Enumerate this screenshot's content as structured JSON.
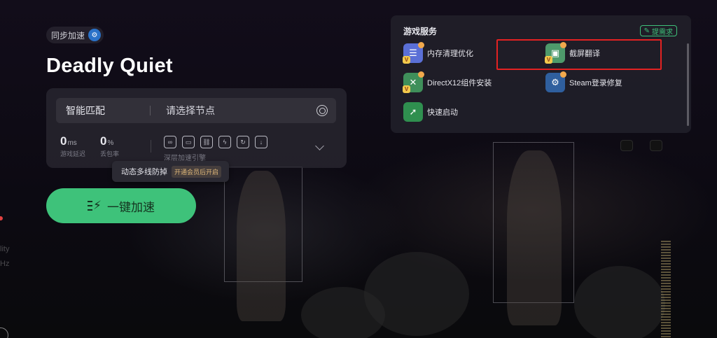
{
  "game": {
    "sync_label": "同步加速",
    "title": "Deadly Quiet"
  },
  "mode": {
    "current": "智能匹配",
    "node_placeholder": "请选择节点"
  },
  "stats": {
    "latency_value": "0",
    "latency_unit": "ms",
    "latency_label": "游戏延迟",
    "loss_value": "0",
    "loss_unit": "%",
    "loss_label": "丢包率",
    "engine_label": "深层加速引擎"
  },
  "tooltip": {
    "text": "动态多线防掉",
    "vip_badge": "开通会员后开启"
  },
  "boost_button": {
    "label": "一键加速"
  },
  "services": {
    "title": "游戏服务",
    "request_label": "提需求",
    "items": [
      {
        "label": "内存清理优化",
        "icon": "memory-cleanup-icon",
        "color": "#5a6fd6"
      },
      {
        "label": "截屏翻译",
        "icon": "screenshot-translate-icon",
        "color": "#4e9a6b"
      },
      {
        "label": "DirectX12组件安装",
        "icon": "directx-icon",
        "color": "#3f8f5a"
      },
      {
        "label": "Steam登录修复",
        "icon": "steam-repair-icon",
        "color": "#2f5f9e"
      },
      {
        "label": "快速启动",
        "icon": "quick-launch-icon",
        "color": "#2f8f4f"
      }
    ]
  },
  "left_edge_text": [
    "lity",
    "Hz"
  ]
}
